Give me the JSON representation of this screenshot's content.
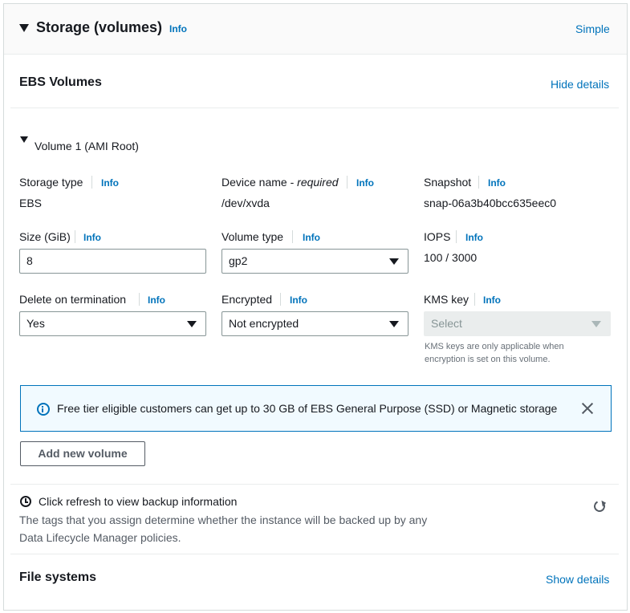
{
  "header": {
    "title": "Storage (volumes)",
    "info": "Info",
    "simple_link": "Simple"
  },
  "ebs": {
    "title": "EBS Volumes",
    "hide_details": "Hide details",
    "volume_title": "Volume 1 (AMI Root)",
    "storage_type": {
      "label": "Storage type",
      "info": "Info",
      "value": "EBS"
    },
    "device_name": {
      "label": "Device name - ",
      "label_required": "required",
      "info": "Info",
      "value": "/dev/xvda"
    },
    "snapshot": {
      "label": "Snapshot",
      "info": "Info",
      "value": "snap-06a3b40bcc635eec0"
    },
    "size": {
      "label": "Size (GiB)",
      "info": "Info",
      "value": "8"
    },
    "volume_type": {
      "label": "Volume type",
      "info": "Info",
      "value": "gp2"
    },
    "iops": {
      "label": "IOPS",
      "info": "Info",
      "value": "100 / 3000"
    },
    "delete_on_termination": {
      "label": "Delete on termination",
      "info": "Info",
      "value": "Yes"
    },
    "encrypted": {
      "label": "Encrypted",
      "info": "Info",
      "value": "Not encrypted"
    },
    "kms_key": {
      "label": "KMS key",
      "info": "Info",
      "placeholder": "Select",
      "help_line1": "KMS keys are only applicable when",
      "help_line2": "encryption is set on this volume."
    }
  },
  "alert": {
    "icon": "info-circle-icon",
    "text": "Free tier eligible customers can get up to 30 GB of EBS General Purpose (SSD) or Magnetic storage",
    "close_icon": "close-icon"
  },
  "add_volume_button": "Add new volume",
  "backup": {
    "icon": "clock-icon",
    "title": "Click refresh to view backup information",
    "description_line1": "The tags that you assign determine whether the instance will be backed up by any",
    "description_line2": "Data Lifecycle Manager policies.",
    "refresh_icon": "refresh-icon"
  },
  "file_systems": {
    "title": "File systems",
    "show_details": "Show details"
  },
  "colors": {
    "link": "#0073bb",
    "alert_bg": "#f1faff",
    "alert_border": "#0073bb",
    "text": "#16191f"
  }
}
